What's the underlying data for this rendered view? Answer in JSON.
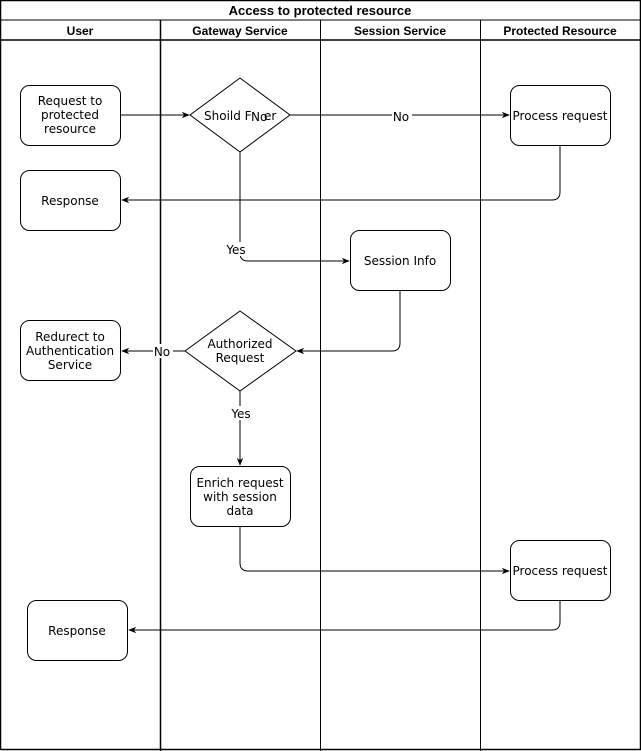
{
  "diagram": {
    "title": "Access to protected resource",
    "lanes": [
      {
        "id": "user",
        "label": "User"
      },
      {
        "id": "gateway",
        "label": "Gateway Service"
      },
      {
        "id": "session",
        "label": "Session Service"
      },
      {
        "id": "resource",
        "label": "Protected Resource"
      }
    ],
    "nodes": [
      {
        "id": "request",
        "shape": "rounded",
        "lines": [
          "Request to",
          "protected",
          "resource"
        ]
      },
      {
        "id": "filter",
        "shape": "diamond",
        "lines": [
          "Shoild F"
        ],
        "overlay": "er"
      },
      {
        "id": "process1",
        "shape": "rounded",
        "lines": [
          "Process request"
        ]
      },
      {
        "id": "response1",
        "shape": "rounded",
        "lines": [
          "Response"
        ]
      },
      {
        "id": "session_info",
        "shape": "rounded",
        "lines": [
          "Session Info"
        ]
      },
      {
        "id": "authorized",
        "shape": "diamond",
        "lines": [
          "Authorized",
          "Request"
        ]
      },
      {
        "id": "redirect",
        "shape": "rounded",
        "lines": [
          "Redurect to",
          "Authentication",
          "Service"
        ]
      },
      {
        "id": "enrich",
        "shape": "rounded",
        "lines": [
          "Enrich request",
          "with session",
          "data"
        ]
      },
      {
        "id": "process2",
        "shape": "rounded",
        "lines": [
          "Process request"
        ]
      },
      {
        "id": "response2",
        "shape": "rounded",
        "lines": [
          "Response"
        ]
      }
    ],
    "edges": [
      {
        "id": "request-to-filter",
        "from": "request",
        "to": "filter",
        "label": ""
      },
      {
        "id": "filter-to-process1",
        "from": "filter",
        "to": "process1",
        "label": "No"
      },
      {
        "id": "process1-to-response1",
        "from": "process1",
        "to": "response1",
        "label": ""
      },
      {
        "id": "filter-to-session-info",
        "from": "filter",
        "to": "session_info",
        "label": "Yes"
      },
      {
        "id": "session-info-to-authorized",
        "from": "session_info",
        "to": "authorized",
        "label": ""
      },
      {
        "id": "authorized-to-redirect",
        "from": "authorized",
        "to": "redirect",
        "label": "No"
      },
      {
        "id": "authorized-to-enrich",
        "from": "authorized",
        "to": "enrich",
        "label": "Yes"
      },
      {
        "id": "enrich-to-process2",
        "from": "enrich",
        "to": "process2",
        "label": ""
      },
      {
        "id": "process2-to-response2",
        "from": "process2",
        "to": "response2",
        "label": ""
      }
    ],
    "colors": {
      "stroke": "#000000",
      "fill": "#ffffff",
      "text": "#000000"
    }
  }
}
